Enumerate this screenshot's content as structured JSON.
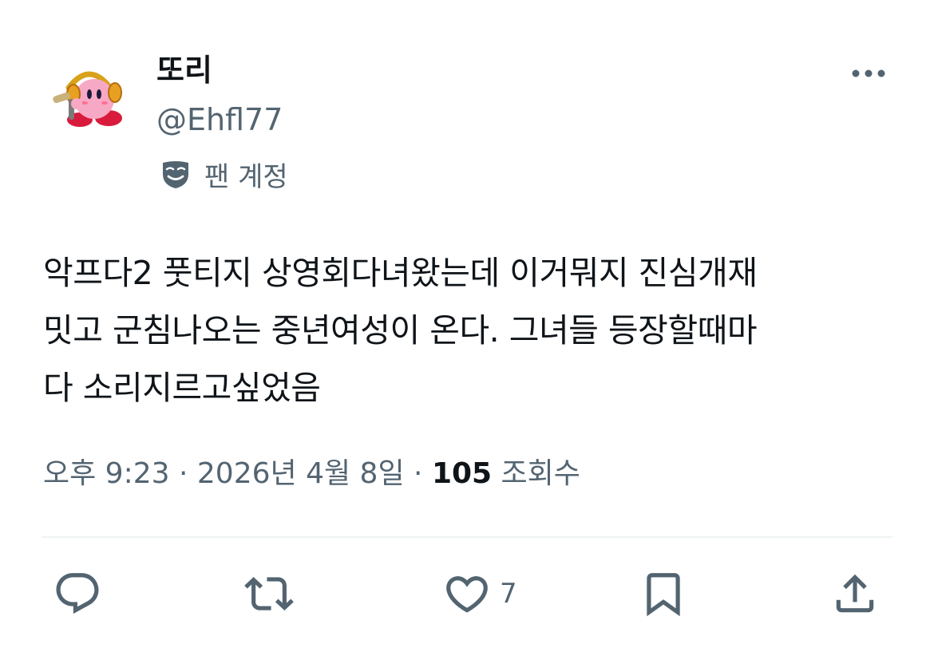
{
  "user": {
    "display_name": "또리",
    "handle": "@Ehfl77",
    "account_label": "팬 계정",
    "avatar_icon": "kirby-headphones-microphone-icon"
  },
  "tweet": {
    "lines": [
      "악프다2 풋티지 상영회다녀왔는데 이거뭐지 진심개재",
      "밋고 군침나오는 중년여성이 온다. 그녀들 등장할때마",
      "다 소리지르고싶었음"
    ]
  },
  "meta": {
    "time": "오후 9:23",
    "separator": "·",
    "date": "2026년 4월 8일",
    "views_count": "105",
    "views_label": "조회수"
  },
  "actions": {
    "reply_icon": "reply-icon",
    "retweet_icon": "retweet-icon",
    "like_icon": "heart-icon",
    "like_count": "7",
    "bookmark_icon": "bookmark-icon",
    "share_icon": "share-icon"
  },
  "colors": {
    "text_primary": "#0f1419",
    "text_secondary": "#536471",
    "divider": "#eff3f4"
  }
}
